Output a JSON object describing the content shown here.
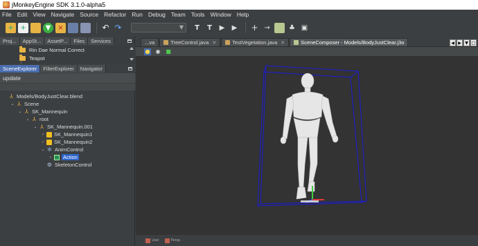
{
  "window": {
    "title": "jMonkeyEngine SDK 3.1.0-alpha5"
  },
  "menu": [
    "File",
    "Edit",
    "View",
    "Navigate",
    "Source",
    "Refactor",
    "Run",
    "Debug",
    "Team",
    "Tools",
    "Window",
    "Help"
  ],
  "toolbar": {
    "icons": [
      "new-project-icon",
      "new-file-icon",
      "open-project-icon",
      "download-icon",
      "close-project-icon",
      "save-icon",
      "save-all-icon",
      "undo-icon",
      "redo-icon",
      "hammer-icon",
      "clean-build-icon",
      "run-icon",
      "debug-icon",
      "add-icon",
      "jump-icon",
      "screenshot-icon",
      "tree-icon",
      "truck-icon"
    ],
    "combo_value": ""
  },
  "projects_panel": {
    "tabs": [
      "Proj...",
      "AppSt...",
      "AssetP...",
      "Files",
      "Services"
    ],
    "items": [
      "Rin Dae Normal Correct",
      "Teapot"
    ]
  },
  "explorer_panel": {
    "tabs": [
      "SceneExplorer",
      "FilterExplorer",
      "Navigator"
    ],
    "filter_label": "update",
    "tree": [
      {
        "label": "Models/BodyJustClear.blend",
        "level": 0,
        "icon": "mesh",
        "toggle": ""
      },
      {
        "label": "Scene",
        "level": 1,
        "icon": "mesh",
        "toggle": "v"
      },
      {
        "label": "SK_Mannequin",
        "level": 2,
        "icon": "mesh",
        "toggle": "v"
      },
      {
        "label": "root",
        "level": 3,
        "icon": "mesh",
        "toggle": "v"
      },
      {
        "label": "SK_Mannequin.001",
        "level": 4,
        "icon": "mesh",
        "toggle": "v"
      },
      {
        "label": "SK_Mannequin1",
        "level": 5,
        "icon": "cube",
        "toggle": ">"
      },
      {
        "label": "SK_Mannequin2",
        "level": 5,
        "icon": "cube",
        "toggle": ">"
      },
      {
        "label": "AnimControl",
        "level": 5,
        "icon": "gear",
        "toggle": "v"
      },
      {
        "label": "Action",
        "level": 6,
        "icon": "film",
        "toggle": ">",
        "selected": true
      },
      {
        "label": "SkeletonControl",
        "level": 5,
        "icon": "skel",
        "toggle": ""
      }
    ]
  },
  "editor": {
    "tabs": [
      {
        "label": "...va",
        "active": false
      },
      {
        "label": "TreeControl.java",
        "active": false
      },
      {
        "label": "TestVegetation.java",
        "active": false
      },
      {
        "label": "SceneComposer - Models/BodyJustClear.j3o",
        "active": true
      }
    ],
    "bottom_labels": [
      "User",
      "Persp."
    ]
  },
  "colors": {
    "accent": "#4b6eaf",
    "selection": "#2f65ca",
    "bounding_box": "#1a1ad8",
    "viewport_bg": "#333333"
  }
}
